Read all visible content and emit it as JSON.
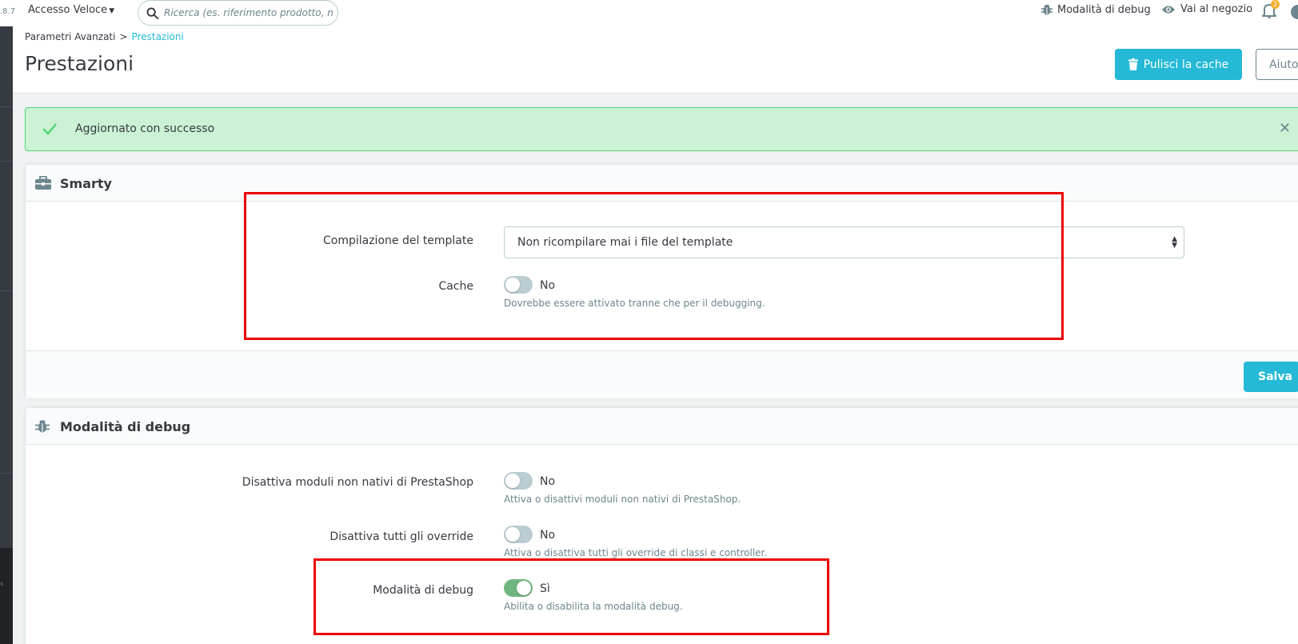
{
  "topbar": {
    "version": ".8.7",
    "quick_access": "Accesso Veloce",
    "search_placeholder": "Ricerca (es. riferimento prodotto, nom",
    "debug_mode": "Modalità di debug",
    "view_shop": "Vai al negozio",
    "notifications_count": "2"
  },
  "header": {
    "breadcrumb_parent": "Parametri Avanzati",
    "breadcrumb_current": "Prestazioni",
    "title": "Prestazioni",
    "clear_cache": "Pulisci la cache",
    "help": "Aiuto"
  },
  "alert": {
    "message": "Aggiornato con successo"
  },
  "smarty": {
    "title": "Smarty",
    "template_compilation_label": "Compilazione del template",
    "template_compilation_value": "Non ricompilare mai i file del template",
    "cache_label": "Cache",
    "cache_value": "No",
    "cache_help": "Dovrebbe essere attivato tranne che per il debugging.",
    "save": "Salva"
  },
  "debug": {
    "title": "Modalità di debug",
    "disable_modules_label": "Disattiva moduli non nativi di PrestaShop",
    "disable_modules_value": "No",
    "disable_modules_help": "Attiva o disattivi moduli non nativi di PrestaShop.",
    "disable_overrides_label": "Disattiva tutti gli override",
    "disable_overrides_value": "No",
    "disable_overrides_help": "Attiva o disattiva tutti gli override di classi e controller.",
    "debug_mode_label": "Modalità di debug",
    "debug_mode_value": "Sì",
    "debug_mode_help": "Abilita o disabilita la modalità debug."
  },
  "colors": {
    "accent": "#25b9d7",
    "success_bg": "#cbf2d4",
    "switch_on": "#70b580",
    "switch_off": "#bbcdd2",
    "highlight": "#ee0000"
  }
}
